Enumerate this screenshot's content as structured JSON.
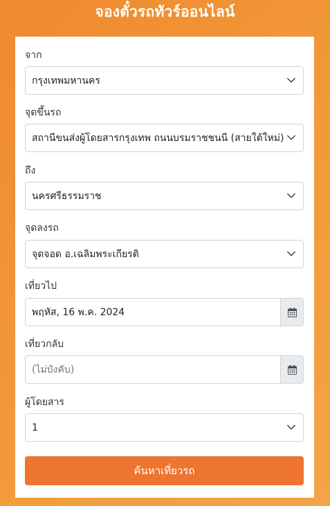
{
  "header": {
    "title": "จองตั๋วรถทัวร์ออนไลน์"
  },
  "form": {
    "from": {
      "label": "จาก",
      "value": "กรุงเทพมหานคร"
    },
    "pickup": {
      "label": "จุดขึ้นรถ",
      "value": "สถานีขนส่งผู้โดยสารกรุงเทพ ถนนบรมราชชนนี (สายใต้ใหม่)"
    },
    "to": {
      "label": "ถึง",
      "value": "นครศรีธรรมราช"
    },
    "dropoff": {
      "label": "จุดลงรถ",
      "value": "จุดจอด อ.เฉลิมพระเกียรติ"
    },
    "depart": {
      "label": "เที่ยวไป",
      "value": "พฤหัส, 16 พ.ค. 2024"
    },
    "return": {
      "label": "เที่ยวกลับ",
      "placeholder": "(ไม่บังคับ)"
    },
    "passengers": {
      "label": "ผู้โดยสาร",
      "value": "1"
    },
    "submit_label": "ค้นหาเที่ยวรถ"
  },
  "colors": {
    "background": "#f0902f",
    "button": "#ee7530",
    "card": "#ffffff"
  }
}
